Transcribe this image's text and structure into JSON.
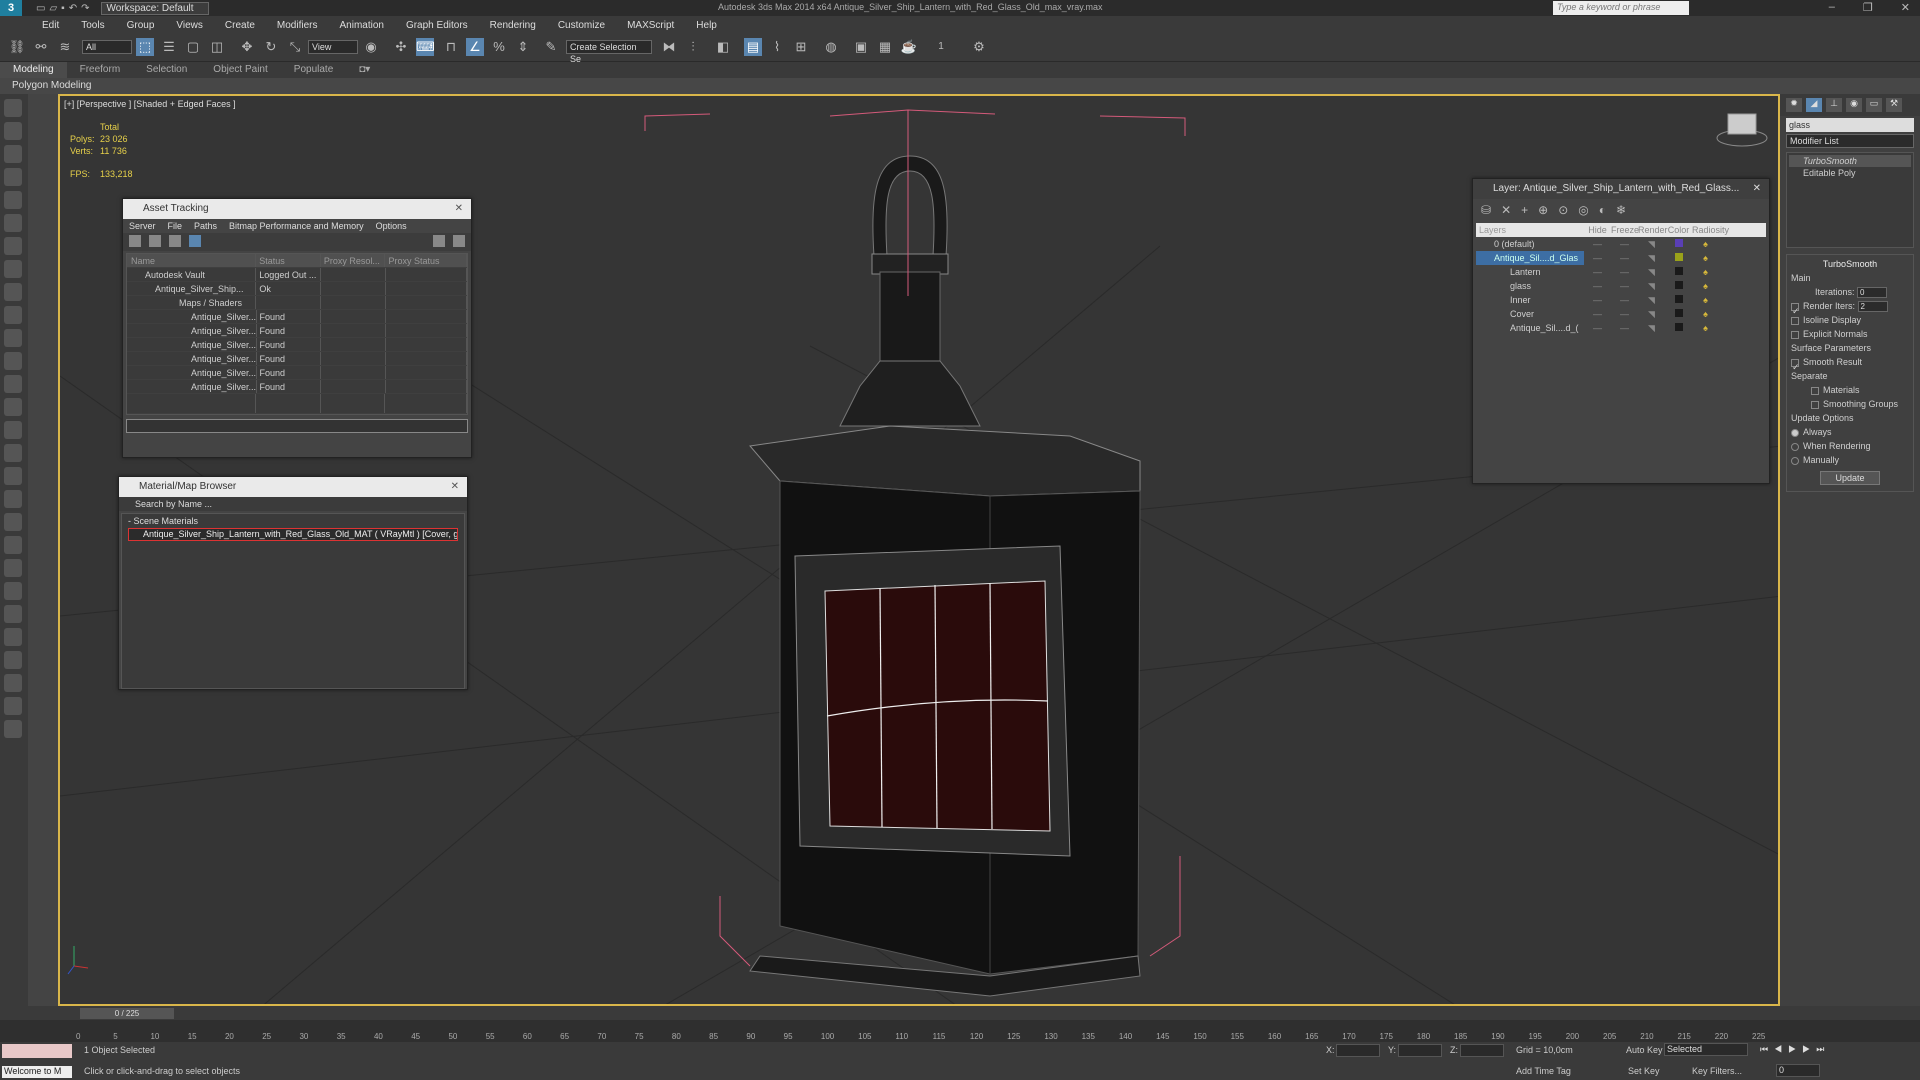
{
  "titlebar": {
    "workspace": "Workspace: Default",
    "title": "Autodesk 3ds Max  2014 x64    Antique_Silver_Ship_Lantern_with_Red_Glass_Old_max_vray.max",
    "search_placeholder": "Type a keyword or phrase"
  },
  "menu": [
    "Edit",
    "Tools",
    "Group",
    "Views",
    "Create",
    "Modifiers",
    "Animation",
    "Graph Editors",
    "Rendering",
    "Customize",
    "MAXScript",
    "Help"
  ],
  "toolbar": {
    "selection_filter": "All",
    "ref_coord": "View",
    "named_selection": "Create Selection Se",
    "spinner_value": "1"
  },
  "ribbon": {
    "tabs": [
      "Modeling",
      "Freeform",
      "Selection",
      "Object Paint",
      "Populate"
    ],
    "sub": "Polygon Modeling"
  },
  "viewport": {
    "label": "[+] [Perspective ] [Shaded + Edged Faces ]",
    "stats": {
      "total_label": "Total",
      "polys_label": "Polys:",
      "polys": "23 026",
      "verts_label": "Verts:",
      "verts": "11 736",
      "fps_label": "FPS:",
      "fps": "133,218"
    }
  },
  "asset_tracking": {
    "title": "Asset Tracking",
    "menu": [
      "Server",
      "File",
      "Paths",
      "Bitmap Performance and Memory",
      "Options"
    ],
    "columns": [
      "Name",
      "Status",
      "Proxy Resol...",
      "Proxy Status"
    ],
    "rows": [
      {
        "name": "Autodesk Vault",
        "status": "Logged Out ..."
      },
      {
        "name": "Antique_Silver_Ship...",
        "status": "Ok"
      },
      {
        "name": "Maps / Shaders",
        "status": ""
      },
      {
        "name": "Antique_Silver...",
        "status": "Found"
      },
      {
        "name": "Antique_Silver...",
        "status": "Found"
      },
      {
        "name": "Antique_Silver...",
        "status": "Found"
      },
      {
        "name": "Antique_Silver...",
        "status": "Found"
      },
      {
        "name": "Antique_Silver...",
        "status": "Found"
      },
      {
        "name": "Antique_Silver...",
        "status": "Found"
      }
    ]
  },
  "material_browser": {
    "title": "Material/Map Browser",
    "search": "Search by Name ...",
    "section": "- Scene Materials",
    "item": "Antique_Silver_Ship_Lantern_with_Red_Glass_Old_MAT ( VRayMtl ) [Cover, g..."
  },
  "layer_window": {
    "title": "Layer: Antique_Silver_Ship_Lantern_with_Red_Glass...",
    "columns": [
      "Layers",
      "Hide",
      "Freeze",
      "Render",
      "Color",
      "Radiosity"
    ],
    "rows": [
      {
        "name": "0 (default)",
        "color": "#5a3fb5"
      },
      {
        "name": "Antique_Sil....d_Glas",
        "color": "#9aa21a"
      },
      {
        "name": "Lantern",
        "color": "#1a1a1a"
      },
      {
        "name": "glass",
        "color": "#1a1a1a"
      },
      {
        "name": "Inner",
        "color": "#1a1a1a"
      },
      {
        "name": "Cover",
        "color": "#1a1a1a"
      },
      {
        "name": "Antique_Sil....d_(",
        "color": "#1a1a1a"
      }
    ]
  },
  "command_panel": {
    "object_name": "glass",
    "modifier_list": "Modifier List",
    "stack": [
      "TurboSmooth",
      "Editable Poly"
    ],
    "turbosmooth": {
      "title": "TurboSmooth",
      "main": "Main",
      "iterations_label": "Iterations:",
      "iterations": "0",
      "render_iters_label": "Render Iters:",
      "render_iters": "2",
      "isoline": "Isoline Display",
      "explicit_normals": "Explicit Normals",
      "surface_params": "Surface Parameters",
      "smooth_result": "Smooth Result",
      "separate": "Separate",
      "materials": "Materials",
      "smoothing_groups": "Smoothing Groups",
      "update_options": "Update Options",
      "always": "Always",
      "when_rendering": "When Rendering",
      "manually": "Manually",
      "update": "Update"
    }
  },
  "timeline": {
    "slider": "0 / 225",
    "ticks": [
      "0",
      "5",
      "10",
      "15",
      "20",
      "25",
      "30",
      "35",
      "40",
      "45",
      "50",
      "55",
      "60",
      "65",
      "70",
      "75",
      "80",
      "85",
      "90",
      "95",
      "100",
      "105",
      "110",
      "115",
      "120",
      "125",
      "130",
      "135",
      "140",
      "145",
      "150",
      "155",
      "160",
      "165",
      "170",
      "175",
      "180",
      "185",
      "190",
      "195",
      "200",
      "205",
      "210",
      "215",
      "220",
      "225"
    ]
  },
  "status": {
    "welcome": "Welcome to M",
    "selected": "1 Object Selected",
    "prompt": "Click or click-and-drag to select objects",
    "x_label": "X:",
    "y_label": "Y:",
    "z_label": "Z:",
    "grid": "Grid = 10,0cm",
    "add_time_tag": "Add Time Tag",
    "auto_key": "Auto Key",
    "selected_dd": "Selected",
    "set_key": "Set Key",
    "key_filters": "Key Filters...",
    "frame": "0"
  }
}
